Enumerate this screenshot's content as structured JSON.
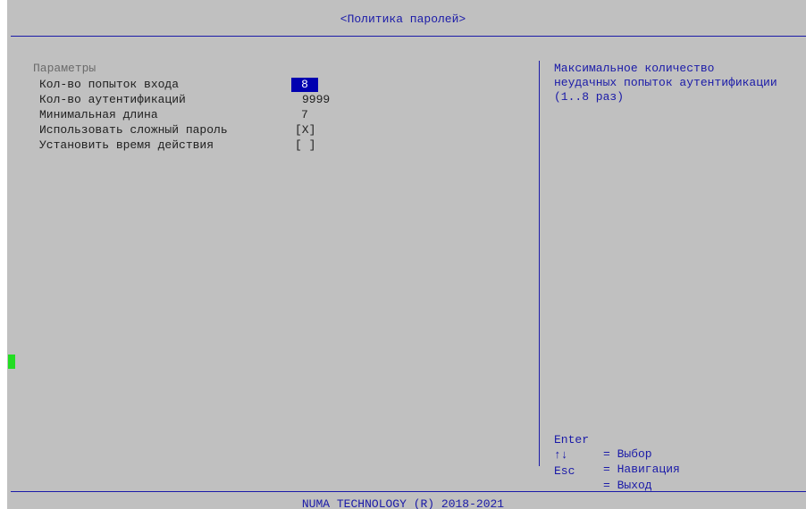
{
  "header": {
    "title": "<Политика паролей>"
  },
  "settings": {
    "section_label": "Параметры",
    "options": [
      {
        "label": "Кол-во попыток входа",
        "value": "8"
      },
      {
        "label": "Кол-во аутентификаций",
        "value": "9999"
      },
      {
        "label": "Минимальная длина",
        "value": "7"
      },
      {
        "label": "Использовать сложный пароль",
        "value": "[X]"
      },
      {
        "label": "Установить время действия",
        "value": "[ ]"
      }
    ]
  },
  "help": {
    "text": "Максимальное количество\nнеудачных попыток аутентификации\n(1..8 раз)"
  },
  "keys": [
    {
      "key": "Enter",
      "action": "= Выбор"
    },
    {
      "key": "↑↓",
      "action": "= Навигация"
    },
    {
      "key": "Esc",
      "action": "= Выход"
    }
  ],
  "footer": {
    "text": "NUMA TECHNOLOGY (R) 2018-2021"
  },
  "colors": {
    "background": "#c0c0c0",
    "accent": "#1a1aa8",
    "selection": "#0000b0",
    "cursor": "#22dd22"
  }
}
